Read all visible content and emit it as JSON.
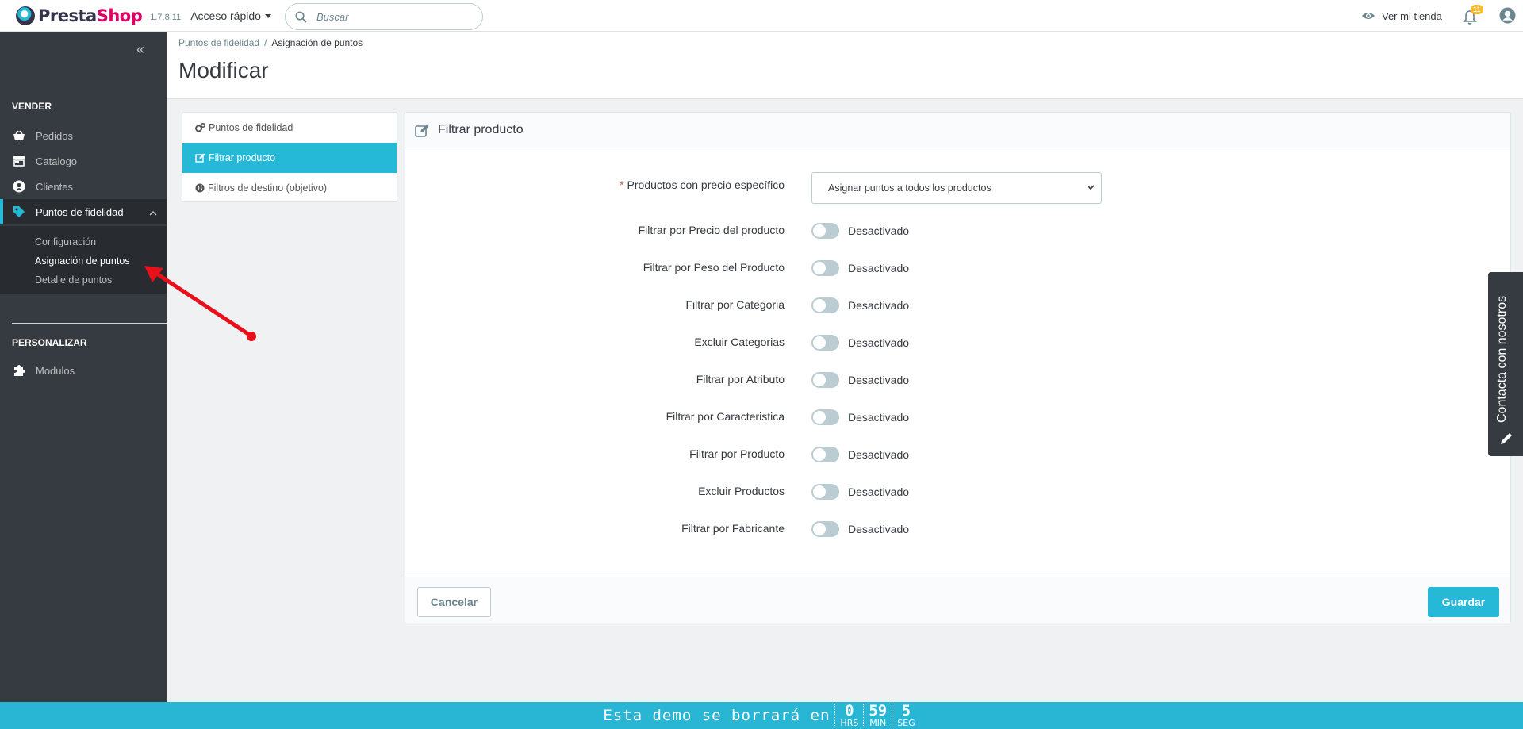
{
  "header": {
    "brand_presta": "Presta",
    "brand_shop": "Shop",
    "version": "1.7.8.11",
    "quick_access": "Acceso rápido",
    "search_placeholder": "Buscar",
    "view_store": "Ver mi tienda",
    "notifications_count": "11"
  },
  "sidebar": {
    "sections": [
      {
        "title": "VENDER",
        "items": [
          {
            "label": "Pedidos",
            "icon": "basket-icon"
          },
          {
            "label": "Catalogo",
            "icon": "store-icon"
          },
          {
            "label": "Clientes",
            "icon": "user-circle-icon"
          },
          {
            "label": "Puntos de fidelidad",
            "icon": "tag-icon",
            "active": true
          }
        ]
      },
      {
        "title": "PERSONALIZAR",
        "items": [
          {
            "label": "Modulos",
            "icon": "puzzle-icon"
          }
        ]
      }
    ],
    "submenu": [
      "Configuración",
      "Asignación de puntos",
      "Detalle de puntos"
    ]
  },
  "breadcrumb": {
    "parent": "Puntos de fidelidad",
    "sep": "/",
    "current": "Asignación de puntos"
  },
  "page_title": "Modificar",
  "tabs": [
    {
      "label": "Puntos de fidelidad",
      "icon": "cogs-icon"
    },
    {
      "label": "Filtrar producto",
      "icon": "edit-icon",
      "active": true
    },
    {
      "label": "Filtros de destino (objetivo)",
      "icon": "globe-icon"
    }
  ],
  "panel": {
    "title": "Filtrar producto",
    "select_row": {
      "label": "Productos con precio específico",
      "required_mark": "*",
      "value": "Asignar puntos a todos los productos"
    },
    "switch_off_label": "Desactivado",
    "switches": [
      "Filtrar por Precio del producto",
      "Filtrar por Peso del Producto",
      "Filtrar por Categoria",
      "Excluir Categorias",
      "Filtrar por Atributo",
      "Filtrar por Caracteristica",
      "Filtrar por Producto",
      "Excluir Productos",
      "Filtrar por Fabricante"
    ],
    "cancel": "Cancelar",
    "save": "Guardar"
  },
  "contact_tab": "Contacta con nosotros",
  "countdown": {
    "text": "Esta demo se borrará en",
    "hours": "0",
    "hours_label": "HRS",
    "minutes": "59",
    "minutes_label": "MIN",
    "seconds": "5",
    "seconds_label": "SEG"
  },
  "colors": {
    "accent": "#25b9d7",
    "sidebar": "#363a41",
    "brand_pink": "#df0067",
    "badge": "#fbbb22",
    "annotation": "#e8101a"
  }
}
